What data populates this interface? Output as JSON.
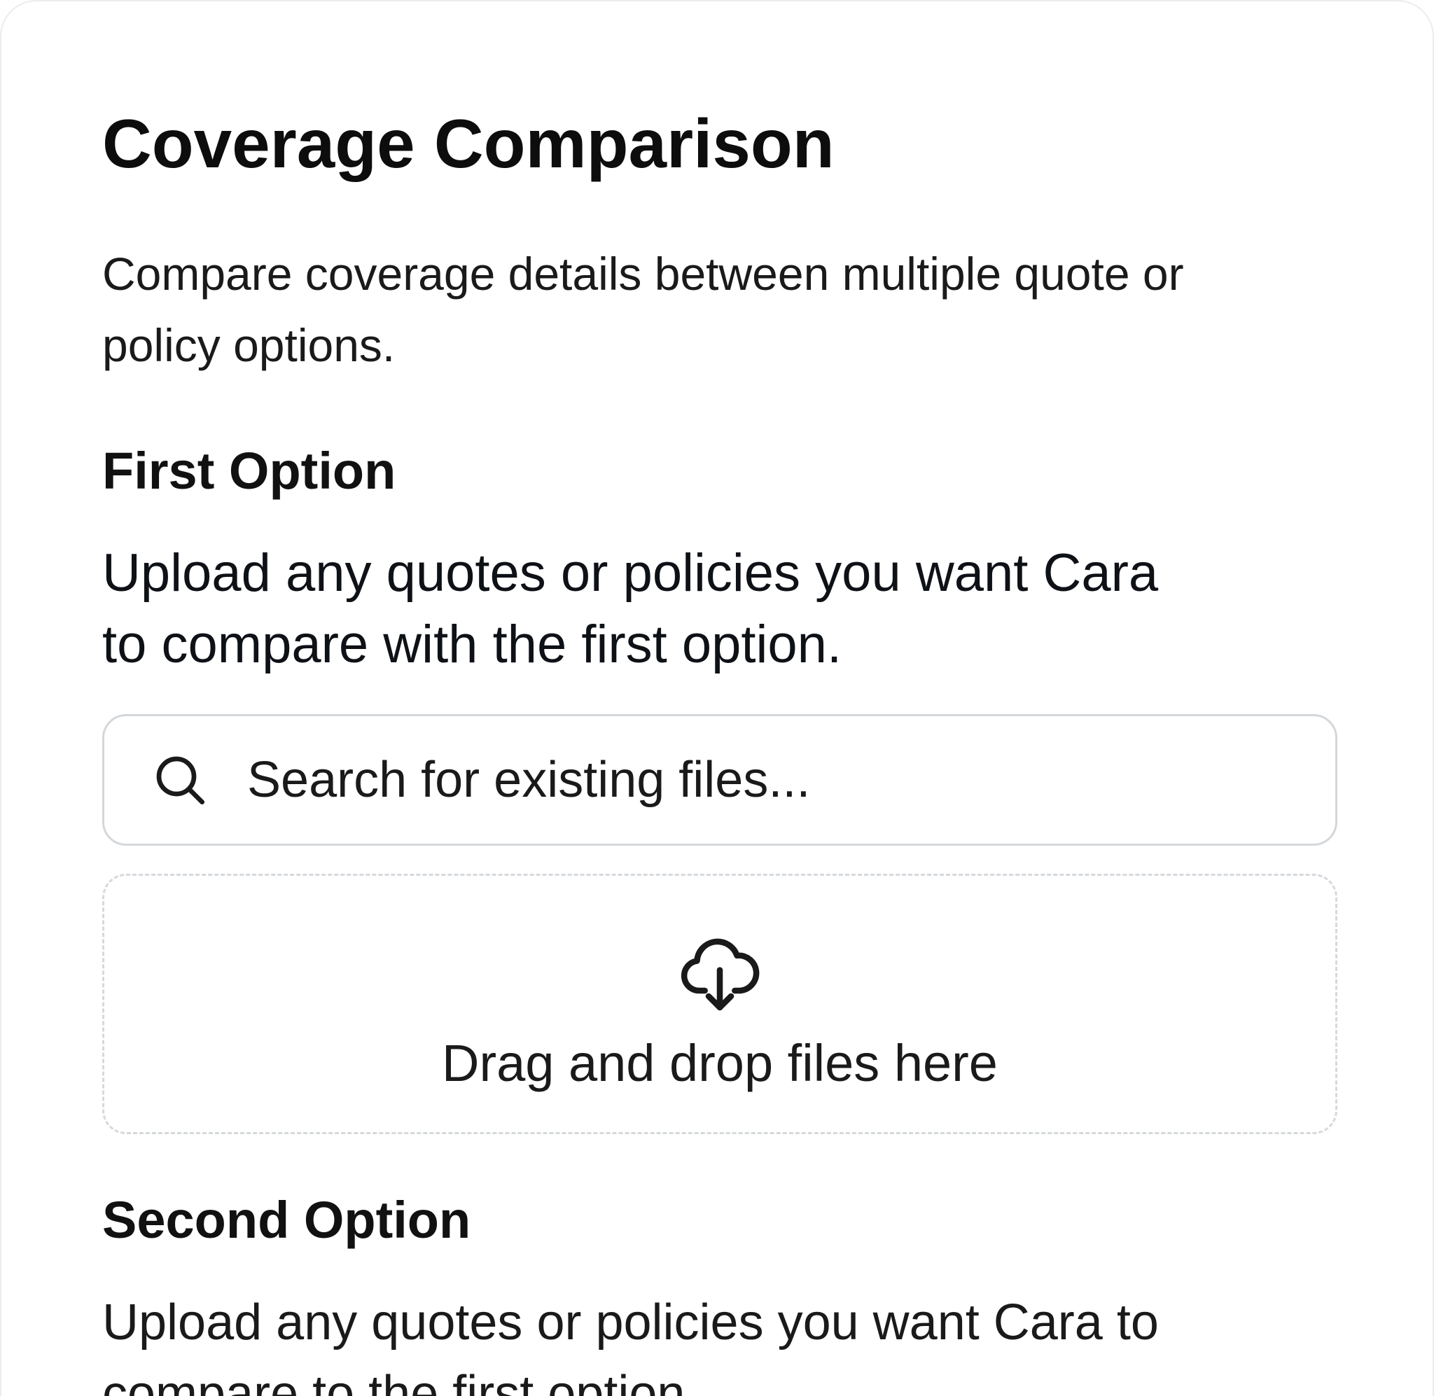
{
  "header": {
    "title": "Coverage Comparison",
    "subtitle": "Compare coverage details between multiple quote or policy options."
  },
  "first_option": {
    "heading": "First Option",
    "description": "Upload any quotes or policies you want Cara to compare with the first option.",
    "search": {
      "placeholder": "Search for existing files...",
      "icon": "search-icon"
    },
    "dropzone": {
      "label": "Drag and drop files here",
      "icon": "cloud-download-icon"
    }
  },
  "second_option": {
    "heading": "Second Option",
    "description": "Upload any quotes or policies you want Cara to compare to the first option."
  },
  "colors": {
    "text_primary": "#111111",
    "border": "#d4d7da",
    "dashed_border": "#d6d9dc",
    "background": "#ffffff"
  }
}
